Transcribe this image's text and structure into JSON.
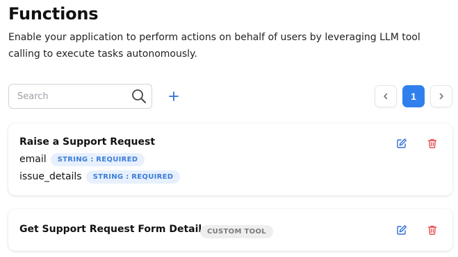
{
  "header": {
    "title": "Functions",
    "description": "Enable your application to perform actions on behalf of users by leveraging LLM tool calling to execute tasks autonomously."
  },
  "toolbar": {
    "search_placeholder": "Search",
    "search_value": "",
    "search_icon": "search-icon",
    "add_icon": "plus-icon"
  },
  "pagination": {
    "current_page": "1",
    "prev_icon": "chevron-left-icon",
    "next_icon": "chevron-right-icon"
  },
  "functions": [
    {
      "name": "Raise a Support Request",
      "params": [
        {
          "name": "email",
          "type": "STRING : REQUIRED"
        },
        {
          "name": "issue_details",
          "type": "STRING : REQUIRED"
        }
      ],
      "edit_icon": "edit-icon",
      "delete_icon": "trash-icon"
    },
    {
      "name": "Get Support Request Form Details",
      "badge": "CUSTOM TOOL",
      "edit_icon": "edit-icon",
      "delete_icon": "trash-icon"
    }
  ],
  "colors": {
    "accent": "#2f80ed",
    "badge_type_bg": "#e7f0fc",
    "badge_type_text": "#3b7dd8",
    "badge_tool_bg": "#eeeeee",
    "badge_tool_text": "#7a7a7a",
    "delete": "#e5484d",
    "edit": "#2f6fd8"
  }
}
